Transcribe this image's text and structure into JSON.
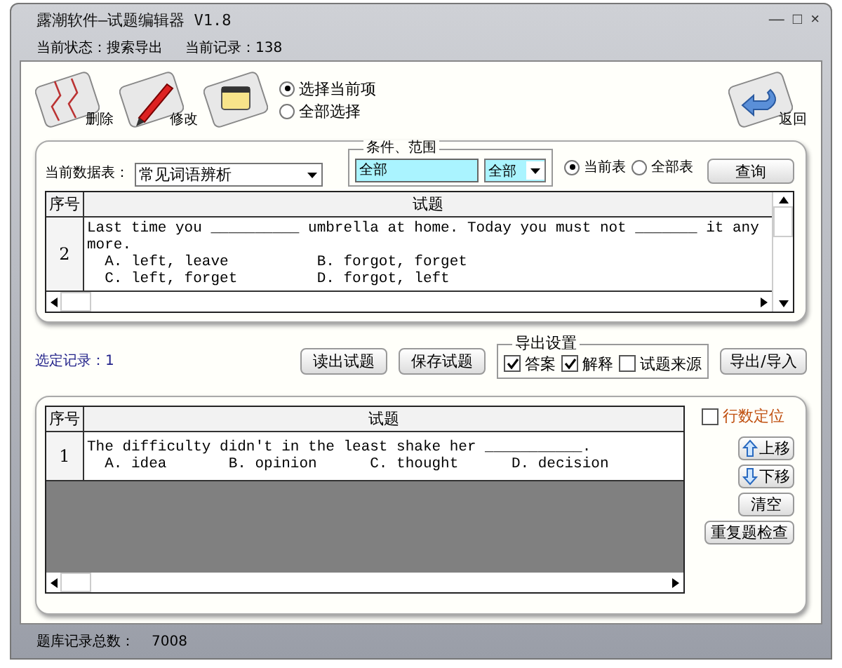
{
  "window": {
    "title": "露潮软件—试题编辑器 V1.8",
    "controls": [
      "—",
      "□",
      "×"
    ]
  },
  "status": {
    "state": "当前状态：搜索导出",
    "record": "当前记录：138"
  },
  "toolbar": [
    {
      "kind": "delete",
      "label": "删除"
    },
    {
      "kind": "edit",
      "label": "修改"
    },
    {
      "kind": "note"
    }
  ],
  "select_mode": [
    {
      "label": "选择当前项",
      "selected": true
    },
    {
      "label": "全部选择",
      "selected": false
    }
  ],
  "back_button": {
    "label": "返回"
  },
  "query": {
    "table_label": "当前数据表：",
    "table_value": "常见词语辨析",
    "condition_legend": "条件、范围",
    "condition_value": "全部",
    "range_value": "全部",
    "scope": [
      {
        "label": "当前表",
        "selected": true
      },
      {
        "label": "全部表",
        "selected": false
      }
    ],
    "button": "查询"
  },
  "upper_table": {
    "columns": [
      "序号",
      "试题"
    ],
    "rows": [
      {
        "number": "2",
        "lines": [
          "Last time you __________ umbrella at home. Today you must not _______ it any",
          "more.",
          "  A. left, leave          B. forgot, forget",
          "  C. left, forget         D. forgot, left"
        ]
      }
    ]
  },
  "selected_count": "选定记录：1",
  "actions": [
    "读出试题",
    "保存试题"
  ],
  "export": {
    "legend": "导出设置",
    "options": [
      {
        "label": "答案",
        "checked": true
      },
      {
        "label": "解释",
        "checked": true
      },
      {
        "label": "试题来源",
        "checked": false
      }
    ],
    "button": "导出/导入"
  },
  "lower_table": {
    "columns": [
      "序号",
      "试题"
    ],
    "rows": [
      {
        "number": "1",
        "lines": [
          "The difficulty didn't in the least shake her ___________.",
          "  A. idea       B. opinion      C. thought      D. decision"
        ]
      }
    ]
  },
  "line_locate": {
    "label": "行数定位",
    "checked": false
  },
  "side_buttons": [
    {
      "kind": "up",
      "label": "上移"
    },
    {
      "kind": "down",
      "label": "下移"
    },
    {
      "kind": "plain",
      "label": "清空"
    },
    {
      "kind": "plain",
      "label": "重复题检查"
    }
  ],
  "footer": {
    "label": "题库记录总数：",
    "value": "7008"
  }
}
